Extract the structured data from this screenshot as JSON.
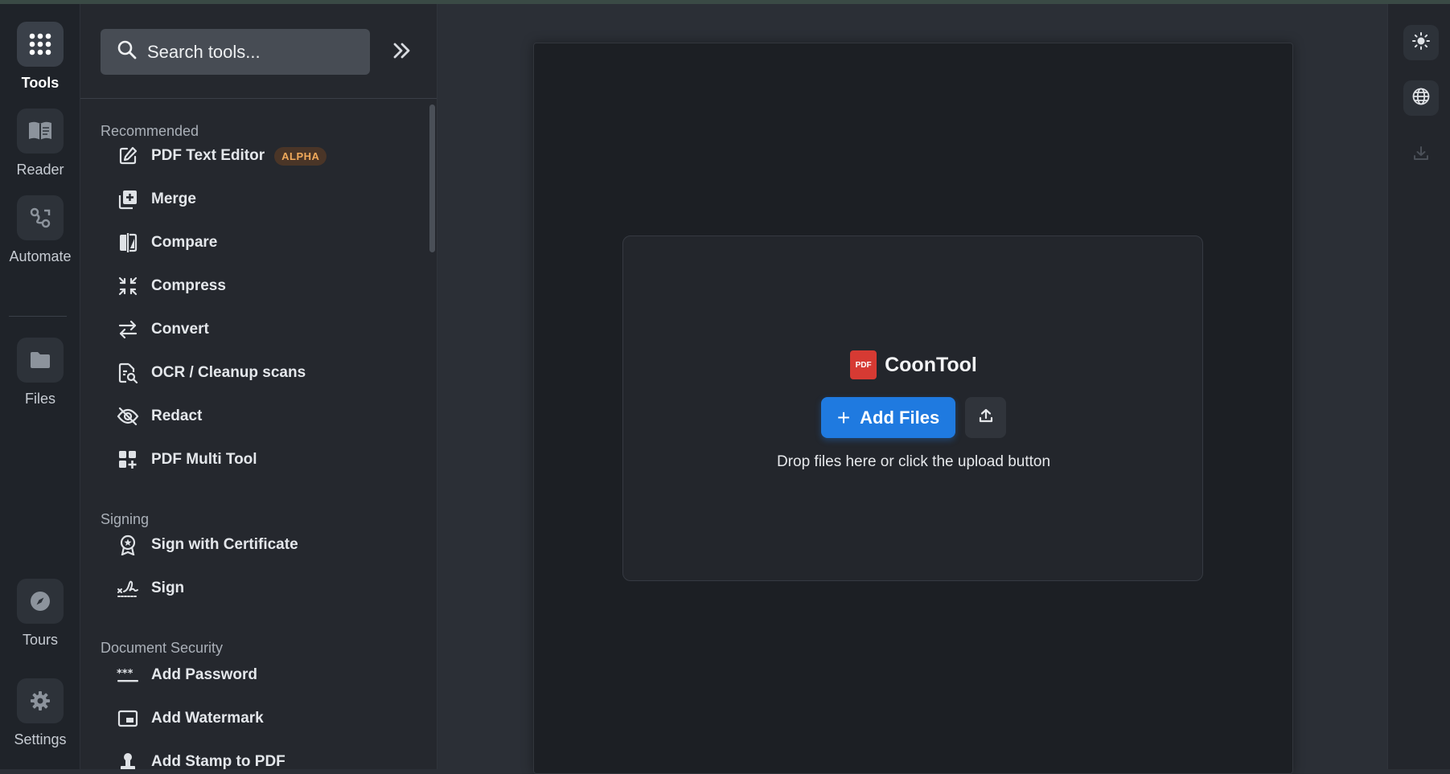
{
  "rail": {
    "items": [
      {
        "label": "Tools",
        "icon": "grid-icon",
        "active": true
      },
      {
        "label": "Reader",
        "icon": "book-icon"
      },
      {
        "label": "Automate",
        "icon": "automate-icon"
      },
      {
        "label": "Files",
        "icon": "folder-icon"
      },
      {
        "label": "Tours",
        "icon": "compass-icon"
      },
      {
        "label": "Settings",
        "icon": "gear-icon"
      }
    ]
  },
  "panel": {
    "search_placeholder": "Search tools...",
    "sections": [
      {
        "title": "Recommended",
        "tools": [
          {
            "label": "PDF Text Editor",
            "badge": "ALPHA",
            "icon": "edit-icon"
          },
          {
            "label": "Merge",
            "icon": "merge-icon"
          },
          {
            "label": "Compare",
            "icon": "compare-icon"
          },
          {
            "label": "Compress",
            "icon": "compress-icon"
          },
          {
            "label": "Convert",
            "icon": "convert-icon"
          },
          {
            "label": "OCR / Cleanup scans",
            "icon": "ocr-icon"
          },
          {
            "label": "Redact",
            "icon": "eye-off-icon"
          },
          {
            "label": "PDF Multi Tool",
            "icon": "multi-tool-icon"
          }
        ]
      },
      {
        "title": "Signing",
        "tools": [
          {
            "label": "Sign with Certificate",
            "icon": "certificate-icon"
          },
          {
            "label": "Sign",
            "icon": "signature-icon"
          }
        ]
      },
      {
        "title": "Document Security",
        "tools": [
          {
            "label": "Add Password",
            "icon": "password-icon"
          },
          {
            "label": "Add Watermark",
            "icon": "watermark-icon"
          },
          {
            "label": "Add Stamp to PDF",
            "icon": "stamp-icon"
          }
        ]
      }
    ]
  },
  "main": {
    "brand_name": "CoonTool",
    "logo_text": "PDF",
    "add_files_label": "Add Files",
    "drop_hint": "Drop files here or click the upload button"
  },
  "right_rail": {
    "icons": [
      "theme-sun-icon",
      "language-globe-icon",
      "download-icon"
    ]
  },
  "colors": {
    "accent": "#1f7ae0",
    "badge_text": "#f1a95a",
    "logo_red": "#d63a33"
  }
}
